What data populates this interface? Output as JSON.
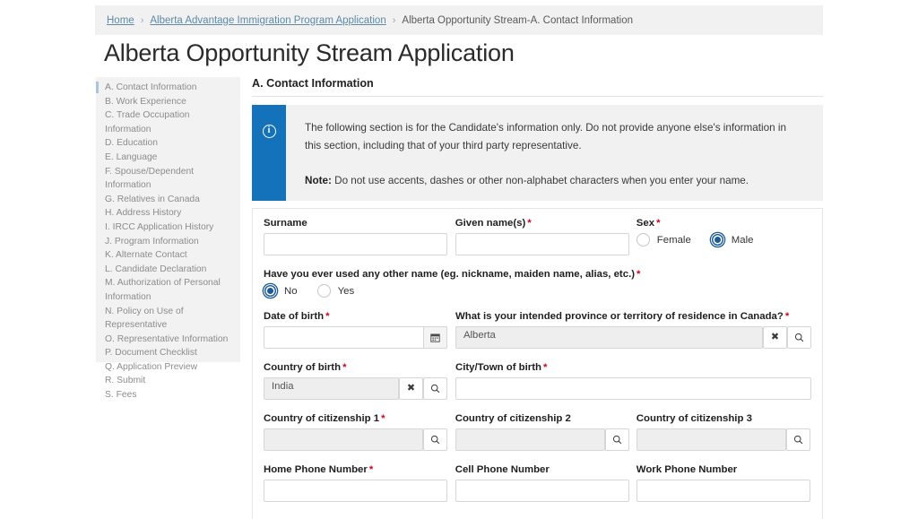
{
  "breadcrumb": {
    "home": "Home",
    "program": "Alberta Advantage Immigration Program Application",
    "current": "Alberta Opportunity Stream-A. Contact Information",
    "separator": "›"
  },
  "page": {
    "title": "Alberta Opportunity Stream Application"
  },
  "sidebar": {
    "items": [
      {
        "label": "A. Contact Information",
        "active": true
      },
      {
        "label": "B. Work Experience",
        "active": false
      },
      {
        "label": "C. Trade Occupation Information",
        "active": false
      },
      {
        "label": "D. Education",
        "active": false
      },
      {
        "label": "E. Language",
        "active": false
      },
      {
        "label": "F. Spouse/Dependent Information",
        "active": false
      },
      {
        "label": "G. Relatives in Canada",
        "active": false
      },
      {
        "label": "H. Address History",
        "active": false
      },
      {
        "label": "I. IRCC Application History",
        "active": false
      },
      {
        "label": "J. Program Information",
        "active": false
      },
      {
        "label": "K. Alternate Contact",
        "active": false
      },
      {
        "label": "L. Candidate Declaration",
        "active": false
      },
      {
        "label": "M. Authorization of Personal Information",
        "active": false
      },
      {
        "label": "N. Policy on Use of Representative",
        "active": false
      },
      {
        "label": "O. Representative Information",
        "active": false
      },
      {
        "label": "P. Document Checklist",
        "active": false
      },
      {
        "label": "Q. Application Preview",
        "active": false
      },
      {
        "label": "R. Submit",
        "active": false
      },
      {
        "label": "S. Fees",
        "active": false
      }
    ]
  },
  "main": {
    "section_title": "A. Contact Information",
    "banner": {
      "icon": "info-icon",
      "paragraph": "The following section is for the Candidate's information only. Do not provide anyone else's information in this section, including that of your third party representative.",
      "note_label": "Note:",
      "note_text": " Do not use accents, dashes or other non-alphabet characters when you enter your name."
    },
    "fields": {
      "surname": {
        "label": "Surname",
        "required": false,
        "value": ""
      },
      "given_names": {
        "label": "Given name(s)",
        "required": true,
        "value": ""
      },
      "sex": {
        "label": "Sex",
        "required": true,
        "options": [
          {
            "label": "Female",
            "selected": false
          },
          {
            "label": "Male",
            "selected": true
          }
        ]
      },
      "other_name": {
        "label": "Have you ever used any other name (eg. nickname, maiden name, alias, etc.)",
        "required": true,
        "options": [
          {
            "label": "No",
            "selected": true
          },
          {
            "label": "Yes",
            "selected": false
          }
        ]
      },
      "date_of_birth": {
        "label": "Date of birth",
        "required": true,
        "value": ""
      },
      "intended_province": {
        "label": "What is your intended province or territory of residence in Canada?",
        "required": true,
        "value": "Alberta"
      },
      "country_of_birth": {
        "label": "Country of birth",
        "required": true,
        "value": "India"
      },
      "city_of_birth": {
        "label": "City/Town of birth",
        "required": true,
        "value": ""
      },
      "citizenship_1": {
        "label": "Country of citizenship 1",
        "required": true,
        "value": ""
      },
      "citizenship_2": {
        "label": "Country of citizenship 2",
        "required": false,
        "value": ""
      },
      "citizenship_3": {
        "label": "Country of citizenship 3",
        "required": false,
        "value": ""
      },
      "home_phone": {
        "label": "Home Phone Number",
        "required": true,
        "value": ""
      },
      "cell_phone": {
        "label": "Cell Phone Number",
        "required": false,
        "value": ""
      },
      "work_phone": {
        "label": "Work Phone Number",
        "required": false,
        "value": ""
      }
    },
    "icons": {
      "calendar": "calendar-icon",
      "clear": "✖",
      "search": "search-icon"
    }
  },
  "colors": {
    "accent_blue": "#1372b9",
    "radio_blue": "#1a5a96",
    "required_red": "#d0021b",
    "strip_grey": "#f1f1f1",
    "link_blue": "#5d8aa8"
  }
}
